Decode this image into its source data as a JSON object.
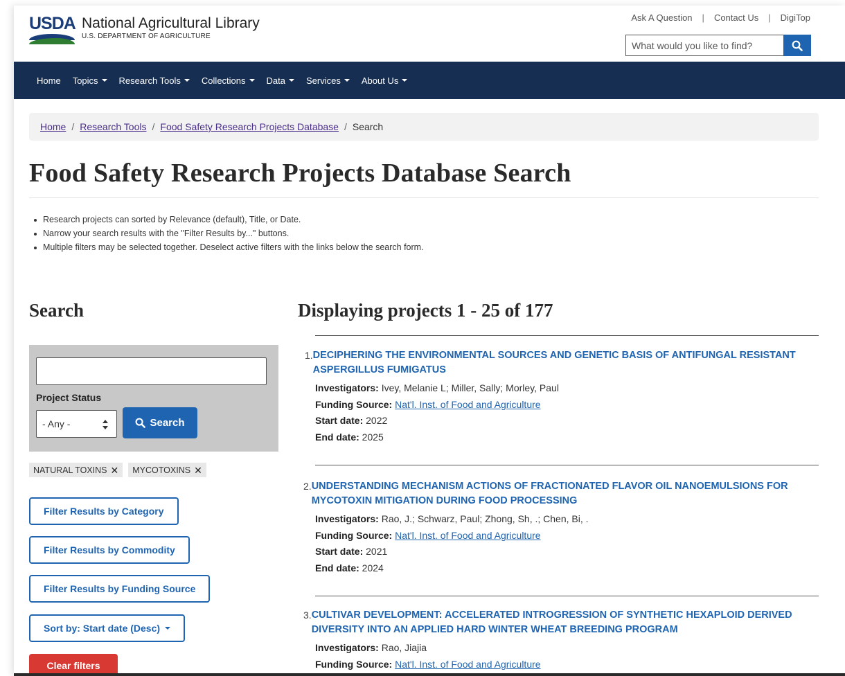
{
  "header": {
    "logo_mark": "USDA",
    "title": "National Agricultural Library",
    "subtitle": "U.S. DEPARTMENT OF AGRICULTURE",
    "top_links": [
      "Ask A Question",
      "Contact Us",
      "DigiTop"
    ],
    "search_placeholder": "What would you like to find?"
  },
  "nav": {
    "items": [
      {
        "label": "Home",
        "dropdown": false
      },
      {
        "label": "Topics",
        "dropdown": true
      },
      {
        "label": "Research Tools",
        "dropdown": true
      },
      {
        "label": "Collections",
        "dropdown": true
      },
      {
        "label": "Data",
        "dropdown": true
      },
      {
        "label": "Services",
        "dropdown": true
      },
      {
        "label": "About Us",
        "dropdown": true
      }
    ]
  },
  "breadcrumb": [
    "Home",
    "Research Tools",
    "Food Safety Research Projects Database",
    "Search"
  ],
  "page_title": "Food Safety Research Projects Database Search",
  "bullets": [
    "Research projects can sorted by Relevance (default), Title, or Date.",
    "Narrow your search results with the \"Filter Results by...\" buttons.",
    "Multiple filters may be selected together. Deselect active filters with the links below the search form."
  ],
  "search": {
    "heading": "Search",
    "keyword_value": "",
    "status_label": "Project Status",
    "status_selected": "- Any -",
    "button_label": "Search",
    "active_filters": [
      "NATURAL TOXINS",
      "MYCOTOXINS"
    ],
    "filter_buttons": [
      "Filter Results by Category",
      "Filter Results by Commodity",
      "Filter Results by Funding Source"
    ],
    "sort_label": "Sort by: Start date (Desc)",
    "clear_label": "Clear filters"
  },
  "results": {
    "heading": "Displaying projects 1 - 25 of 177",
    "labels": {
      "investigators": "Investigators:",
      "funding": "Funding Source:",
      "start": "Start date:",
      "end": "End date:"
    },
    "items": [
      {
        "num": "1.",
        "title": "Deciphering the Environmental Sources and Genetic Basis of Antifungal Resistant Aspergillus Fumigatus",
        "investigators": "Ivey, Melanie L; Miller, Sally; Morley, Paul",
        "funding": "Nat'l. Inst. of Food and Agriculture",
        "start": "2022",
        "end": "2025"
      },
      {
        "num": "2.",
        "title": "Understanding Mechanism Actions of Fractionated Flavor Oil Nanoemulsions for Mycotoxin Mitigation During Food Processing",
        "investigators": "Rao, J.; Schwarz, Paul; Zhong, Sh, .; Chen, Bi, .",
        "funding": "Nat'l. Inst. of Food and Agriculture",
        "start": "2021",
        "end": "2024"
      },
      {
        "num": "3.",
        "title": "Cultivar Development: Accelerated Introgression of Synthetic Hexaploid Derived Diversity Into an Applied Hard Winter Wheat Breeding Program",
        "investigators": "Rao, Jiajia",
        "funding": "Nat'l. Inst. of Food and Agriculture"
      }
    ]
  },
  "colors": {
    "nav_bg": "#162e51",
    "accent": "#1f64b0",
    "danger": "#d83933",
    "panel": "#c8c8c8"
  }
}
